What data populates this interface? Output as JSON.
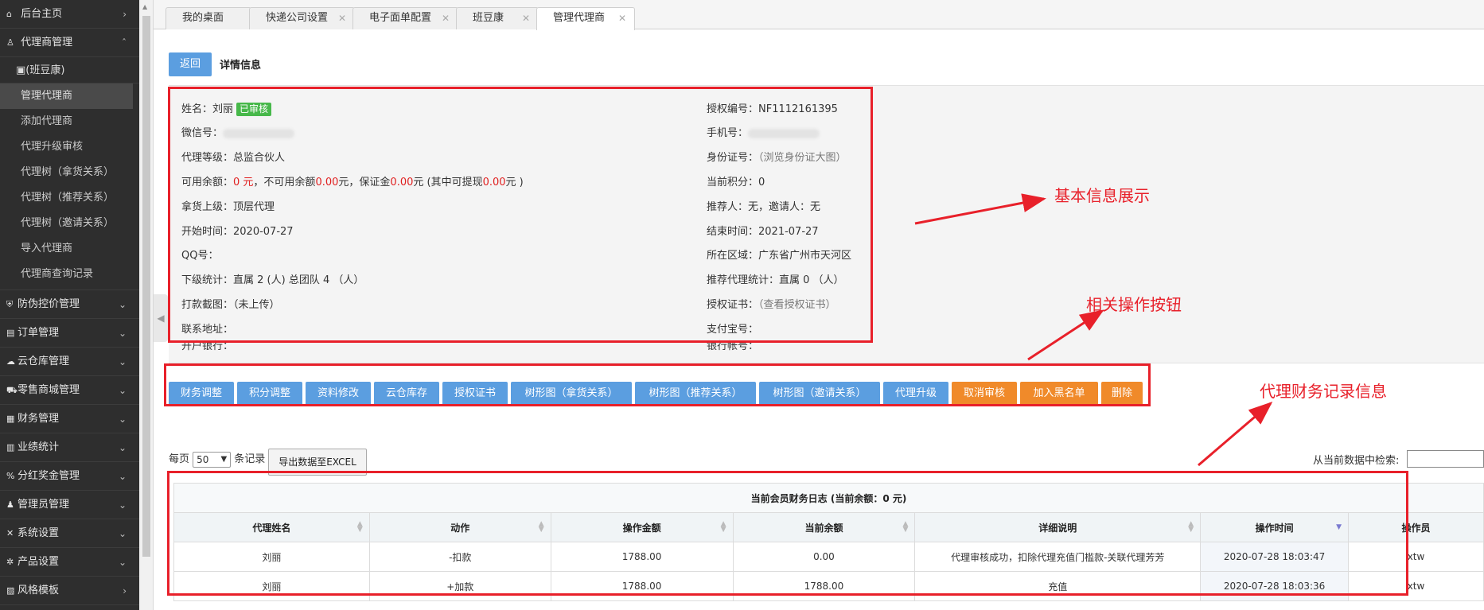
{
  "sidebar": {
    "home": "后台主页",
    "agent_mgmt": "代理商管理",
    "brand": "(班豆康)",
    "sub_items": [
      "管理代理商",
      "添加代理商",
      "代理升级审核",
      "代理树（拿货关系）",
      "代理树（推荐关系）",
      "代理树（邀请关系）",
      "导入代理商",
      "代理商查询记录"
    ],
    "menu": [
      "防伪控价管理",
      "订单管理",
      "云仓库管理",
      "零售商城管理",
      "财务管理",
      "业绩统计",
      "分红奖金管理",
      "管理员管理",
      "系统设置",
      "产品设置",
      "风格模板"
    ]
  },
  "tabs": [
    {
      "label": "我的桌面"
    },
    {
      "label": "快递公司设置"
    },
    {
      "label": "电子面单配置"
    },
    {
      "label": "班豆康"
    },
    {
      "label": "管理代理商"
    }
  ],
  "header": {
    "back": "返回",
    "title": "详情信息"
  },
  "info": {
    "name_label": "姓名：",
    "name": "刘丽",
    "status": "已审核",
    "wechat_label": "微信号：",
    "level_label": "代理等级：",
    "level": "总监合伙人",
    "balance_label": "可用余额：",
    "balance": "0 元",
    "frozen_label": "，不可用余额",
    "frozen": "0.00",
    "frozen_unit": "元，",
    "deposit_label": "保证金",
    "deposit": "0.00",
    "deposit_unit": "元 (其中可提现",
    "withdraw": "0.00",
    "withdraw_unit": "元 )",
    "upline_label": "拿货上级：",
    "upline": "顶层代理",
    "start_label": "开始时间：",
    "start": "2020-07-27",
    "qq_label": "QQ号：",
    "sub_label": "下级统计：",
    "sub": "直属 2 (人) 总团队 4 （人）",
    "screenshot_label": "打款截图：",
    "screenshot": "（未上传）",
    "address_label": "联系地址：",
    "bank_label": "开户银行：",
    "auth_no_label": "授权编号：",
    "auth_no": "NF1112161395",
    "phone_label": "手机号：",
    "idcard_label": "身份证号：",
    "idcard": "（浏览身份证大图）",
    "points_label": "当前积分：",
    "points": "0",
    "referrer_label": "推荐人：",
    "referrer": "无，邀请人：无",
    "end_label": "结束时间：",
    "end": "2021-07-27",
    "region_label": "所在区域：",
    "region": "广东省广州市天河区",
    "ref_stat_label": "推荐代理统计：",
    "ref_stat": "直属 0 （人）",
    "cert_label": "授权证书：",
    "cert": "（查看授权证书）",
    "alipay_label": "支付宝号：",
    "account_label": "银行帐号："
  },
  "actions": [
    "财务调整",
    "积分调整",
    "资料修改",
    "云仓库存",
    "授权证书",
    "树形图（拿货关系）",
    "树形图（推荐关系）",
    "树形图（邀请关系）",
    "代理升级",
    "取消审核",
    "加入黑名单",
    "删除"
  ],
  "annotations": {
    "basic": "基本信息展示",
    "ops": "相关操作按钮",
    "finance": "代理财务记录信息"
  },
  "table_controls": {
    "per_page_prefix": "每页",
    "per_page": "50",
    "per_page_suffix": "条记录",
    "export": "导出数据至EXCEL",
    "search_label": "从当前数据中检索:"
  },
  "log_table": {
    "caption": "当前会员财务日志 (当前余额：0 元)",
    "columns": [
      "代理姓名",
      "动作",
      "操作金额",
      "当前余额",
      "详细说明",
      "操作时间",
      "操作员"
    ],
    "rows": [
      [
        "刘丽",
        "-扣款",
        "1788.00",
        "0.00",
        "代理审核成功，扣除代理充值门槛款-关联代理芳芳",
        "2020-07-28 18:03:47",
        "xtw"
      ],
      [
        "刘丽",
        "+加款",
        "1788.00",
        "1788.00",
        "充值",
        "2020-07-28 18:03:36",
        "xtw"
      ]
    ]
  },
  "colors": {
    "primary": "#5b9ee0",
    "orange": "#f08a2a",
    "annotation_red": "#e8202a",
    "badge_green": "#47b84a"
  }
}
